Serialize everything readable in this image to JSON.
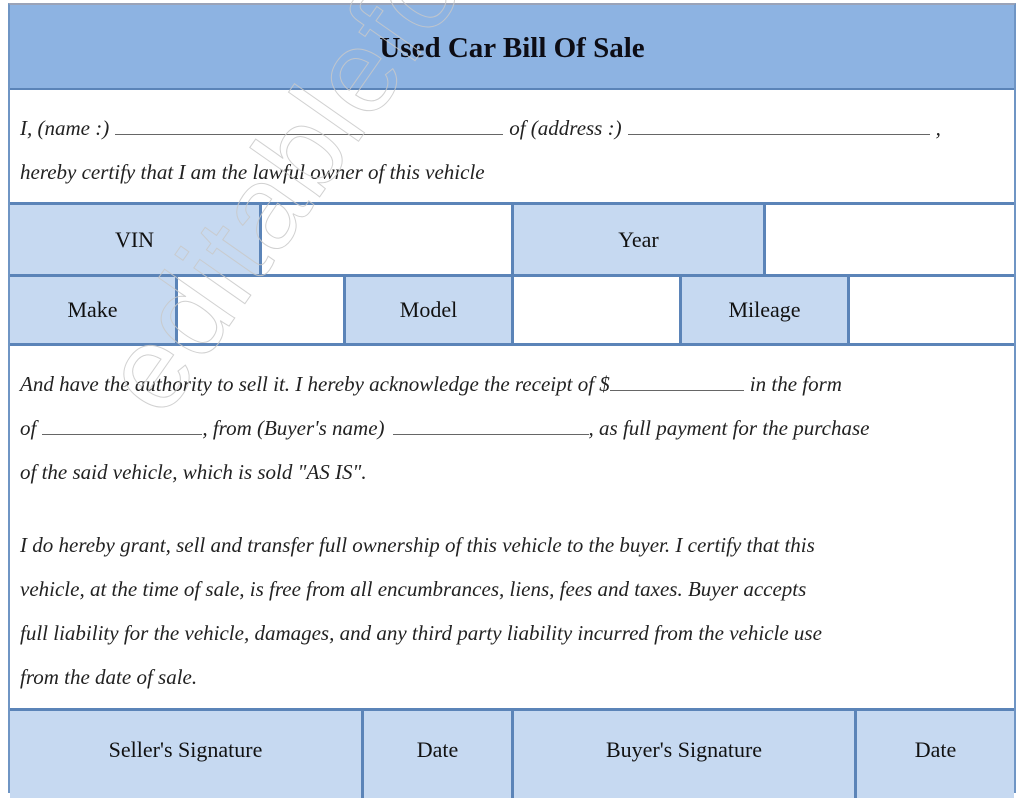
{
  "document": {
    "title": "Used Car Bill Of Sale",
    "watermark": "editableforms.com",
    "colors": {
      "header_bg": "#8db3e2",
      "label_bg": "#c6d9f1",
      "border": "#5b84b8"
    }
  },
  "intro": {
    "name_label": "I, (name :)",
    "address_label": "of (address :)",
    "address_suffix": ",",
    "certify_text": "hereby certify that I am the lawful owner of this vehicle"
  },
  "vehicle_fields": {
    "row1": [
      {
        "label": "VIN",
        "value": ""
      },
      {
        "label": "Year",
        "value": ""
      }
    ],
    "row2": [
      {
        "label": "Make",
        "value": ""
      },
      {
        "label": "Model",
        "value": ""
      },
      {
        "label": "Mileage",
        "value": ""
      }
    ]
  },
  "payment": {
    "line1_prefix": "And have the authority to sell it. I hereby acknowledge the receipt of $",
    "line1_suffix": "in the form",
    "line2_prefix": "of",
    "line2_middle": ", from (Buyer's name)",
    "line2_suffix": ", as full payment for the purchase",
    "line3": "of the said vehicle, which is sold \"AS IS\"."
  },
  "transfer": {
    "lines": [
      "I do hereby grant, sell and transfer full ownership of this vehicle to the buyer. I certify that this",
      "vehicle, at the time of sale, is free from all encumbrances, liens, fees and taxes. Buyer accepts",
      "full liability for the vehicle, damages, and any third party liability incurred from the vehicle use",
      "from the date of sale."
    ]
  },
  "signatures": {
    "seller_signature_label": "Seller's Signature",
    "seller_date_label": "Date",
    "buyer_signature_label": "Buyer's Signature",
    "buyer_date_label": "Date"
  }
}
